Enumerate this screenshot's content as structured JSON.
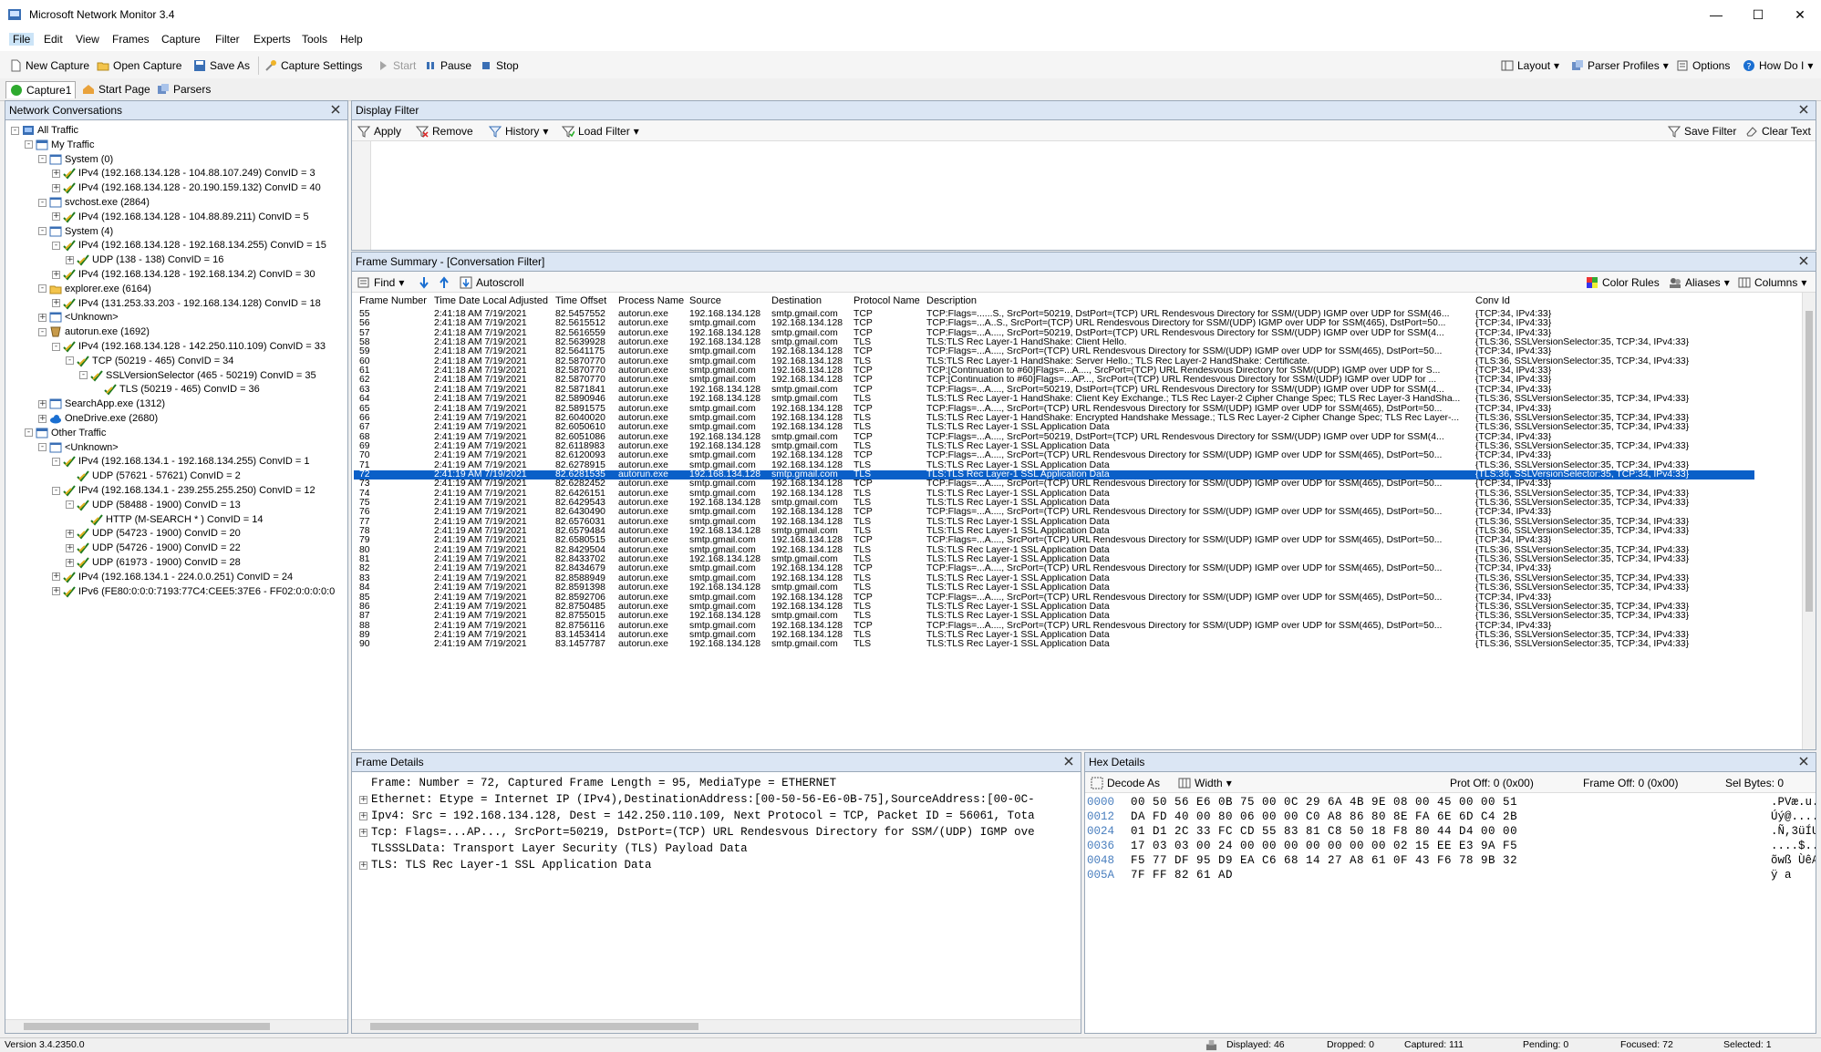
{
  "window": {
    "title": "Microsoft Network Monitor 3.4",
    "controls": {
      "minimize": "—",
      "maximize": "☐",
      "close": "✕"
    }
  },
  "menu": [
    "File",
    "Edit",
    "View",
    "Frames",
    "Capture",
    "Filter",
    "Experts",
    "Tools",
    "Help"
  ],
  "toolbar": {
    "new_capture": "New Capture",
    "open_capture": "Open Capture",
    "save_as": "Save As",
    "capture_settings": "Capture Settings",
    "start": "Start",
    "pause": "Pause",
    "stop": "Stop",
    "layout": "Layout",
    "parser_profiles": "Parser Profiles",
    "options": "Options",
    "how_do_i": "How Do I"
  },
  "doc_tabs": [
    "Capture1",
    "Start Page",
    "Parsers"
  ],
  "conversations": {
    "title": "Network Conversations",
    "tree": [
      {
        "level": 0,
        "exp": "-",
        "icon": "globe",
        "label": "All Traffic"
      },
      {
        "level": 1,
        "exp": "-",
        "icon": "folder",
        "label": "My Traffic"
      },
      {
        "level": 2,
        "exp": "-",
        "icon": "window",
        "label": "System (0)"
      },
      {
        "level": 3,
        "exp": "+",
        "icon": "check",
        "label": "IPv4 (192.168.134.128 - 104.88.107.249) ConvID = 3"
      },
      {
        "level": 3,
        "exp": "+",
        "icon": "check",
        "label": "IPv4 (192.168.134.128 - 20.190.159.132) ConvID = 40"
      },
      {
        "level": 2,
        "exp": "-",
        "icon": "window",
        "label": "svchost.exe (2864)"
      },
      {
        "level": 3,
        "exp": "+",
        "icon": "check",
        "label": "IPv4 (192.168.134.128 - 104.88.89.211) ConvID = 5"
      },
      {
        "level": 2,
        "exp": "-",
        "icon": "window",
        "label": "System (4)"
      },
      {
        "level": 3,
        "exp": "-",
        "icon": "check",
        "label": "IPv4 (192.168.134.128 - 192.168.134.255) ConvID = 15"
      },
      {
        "level": 4,
        "exp": "+",
        "icon": "check",
        "label": "UDP (138 - 138) ConvID = 16"
      },
      {
        "level": 3,
        "exp": "+",
        "icon": "check",
        "label": "IPv4 (192.168.134.128 - 192.168.134.2) ConvID = 30"
      },
      {
        "level": 2,
        "exp": "-",
        "icon": "explorer",
        "label": "explorer.exe (6164)"
      },
      {
        "level": 3,
        "exp": "+",
        "icon": "check",
        "label": "IPv4 (131.253.33.203 - 192.168.134.128) ConvID = 18"
      },
      {
        "level": 2,
        "exp": "+",
        "icon": "window",
        "label": "<Unknown>"
      },
      {
        "level": 2,
        "exp": "-",
        "icon": "autorun",
        "label": "autorun.exe (1692)"
      },
      {
        "level": 3,
        "exp": "-",
        "icon": "check",
        "label": "IPv4 (192.168.134.128 - 142.250.110.109) ConvID = 33"
      },
      {
        "level": 4,
        "exp": "-",
        "icon": "check",
        "label": "TCP (50219 - 465) ConvID = 34"
      },
      {
        "level": 5,
        "exp": "-",
        "icon": "check",
        "label": "SSLVersionSelector (465 - 50219) ConvID = 35"
      },
      {
        "level": 6,
        "exp": "",
        "icon": "check",
        "label": "TLS (50219 - 465) ConvID = 36"
      },
      {
        "level": 2,
        "exp": "+",
        "icon": "window",
        "label": "SearchApp.exe (1312)"
      },
      {
        "level": 2,
        "exp": "+",
        "icon": "cloud",
        "label": "OneDrive.exe (2680)"
      },
      {
        "level": 1,
        "exp": "-",
        "icon": "folder",
        "label": "Other Traffic"
      },
      {
        "level": 2,
        "exp": "-",
        "icon": "window",
        "label": "<Unknown>"
      },
      {
        "level": 3,
        "exp": "-",
        "icon": "check",
        "label": "IPv4 (192.168.134.1 - 192.168.134.255) ConvID = 1"
      },
      {
        "level": 4,
        "exp": "",
        "icon": "check",
        "label": "UDP (57621 - 57621) ConvID = 2"
      },
      {
        "level": 3,
        "exp": "-",
        "icon": "check",
        "label": "IPv4 (192.168.134.1 - 239.255.255.250) ConvID = 12"
      },
      {
        "level": 4,
        "exp": "-",
        "icon": "check",
        "label": "UDP (58488 - 1900) ConvID = 13"
      },
      {
        "level": 5,
        "exp": "",
        "icon": "check",
        "label": "HTTP (M-SEARCH * ) ConvID = 14"
      },
      {
        "level": 4,
        "exp": "+",
        "icon": "check",
        "label": "UDP (54723 - 1900) ConvID = 20"
      },
      {
        "level": 4,
        "exp": "+",
        "icon": "check",
        "label": "UDP (54726 - 1900) ConvID = 22"
      },
      {
        "level": 4,
        "exp": "+",
        "icon": "check",
        "label": "UDP (61973 - 1900) ConvID = 28"
      },
      {
        "level": 3,
        "exp": "+",
        "icon": "check",
        "label": "IPv4 (192.168.134.1 - 224.0.0.251) ConvID = 24"
      },
      {
        "level": 3,
        "exp": "+",
        "icon": "check",
        "label": "IPv6 (FE80:0:0:0:7193:77C4:CEE5:37E6 - FF02:0:0:0:0:0"
      }
    ]
  },
  "display_filter": {
    "title": "Display Filter",
    "apply": "Apply",
    "remove": "Remove",
    "history": "History",
    "load_filter": "Load Filter",
    "save_filter": "Save Filter",
    "clear_text": "Clear Text"
  },
  "frame_summary": {
    "title": "Frame Summary - [Conversation Filter]",
    "find": "Find",
    "autoscroll": "Autoscroll",
    "color_rules": "Color Rules",
    "aliases": "Aliases",
    "columns": "Columns",
    "headers": [
      "Frame Number",
      "Time Date Local Adjusted",
      "Time Offset",
      "Process Name",
      "Source",
      "Destination",
      "Protocol Name",
      "Description",
      "Conv Id"
    ],
    "selected_frame": "72",
    "rows": [
      [
        "55",
        "2:41:18 AM 7/19/2021",
        "82.5457552",
        "autorun.exe",
        "192.168.134.128",
        "smtp.gmail.com",
        "TCP",
        "TCP:Flags=......S., SrcPort=50219, DstPort=(TCP) URL Rendesvous Directory for SSM/(UDP) IGMP over UDP for SSM(46...",
        "{TCP:34, IPv4:33}"
      ],
      [
        "56",
        "2:41:18 AM 7/19/2021",
        "82.5615512",
        "autorun.exe",
        "smtp.gmail.com",
        "192.168.134.128",
        "TCP",
        "TCP:Flags=...A..S., SrcPort=(TCP) URL Rendesvous Directory for SSM/(UDP) IGMP over UDP for SSM(465), DstPort=50...",
        "{TCP:34, IPv4:33}"
      ],
      [
        "57",
        "2:41:18 AM 7/19/2021",
        "82.5616559",
        "autorun.exe",
        "192.168.134.128",
        "smtp.gmail.com",
        "TCP",
        "TCP:Flags=...A...., SrcPort=50219, DstPort=(TCP) URL Rendesvous Directory for SSM/(UDP) IGMP over UDP for SSM(4...",
        "{TCP:34, IPv4:33}"
      ],
      [
        "58",
        "2:41:18 AM 7/19/2021",
        "82.5639928",
        "autorun.exe",
        "192.168.134.128",
        "smtp.gmail.com",
        "TLS",
        "TLS:TLS Rec Layer-1 HandShake: Client Hello.",
        "{TLS:36, SSLVersionSelector:35, TCP:34, IPv4:33}"
      ],
      [
        "59",
        "2:41:18 AM 7/19/2021",
        "82.5641175",
        "autorun.exe",
        "smtp.gmail.com",
        "192.168.134.128",
        "TCP",
        "TCP:Flags=...A...., SrcPort=(TCP) URL Rendesvous Directory for SSM/(UDP) IGMP over UDP for SSM(465), DstPort=50...",
        "{TCP:34, IPv4:33}"
      ],
      [
        "60",
        "2:41:18 AM 7/19/2021",
        "82.5870770",
        "autorun.exe",
        "smtp.gmail.com",
        "192.168.134.128",
        "TLS",
        "TLS:TLS Rec Layer-1 HandShake: Server Hello.; TLS Rec Layer-2 HandShake: Certificate.",
        "{TLS:36, SSLVersionSelector:35, TCP:34, IPv4:33}"
      ],
      [
        "61",
        "2:41:18 AM 7/19/2021",
        "82.5870770",
        "autorun.exe",
        "smtp.gmail.com",
        "192.168.134.128",
        "TCP",
        "TCP:[Continuation to #60]Flags=...A...., SrcPort=(TCP) URL Rendesvous Directory for SSM/(UDP) IGMP over UDP for S...",
        "{TCP:34, IPv4:33}"
      ],
      [
        "62",
        "2:41:18 AM 7/19/2021",
        "82.5870770",
        "autorun.exe",
        "smtp.gmail.com",
        "192.168.134.128",
        "TCP",
        "TCP:[Continuation to #60]Flags=...AP..., SrcPort=(TCP) URL Rendesvous Directory for SSM/(UDP) IGMP over UDP for ...",
        "{TCP:34, IPv4:33}"
      ],
      [
        "63",
        "2:41:18 AM 7/19/2021",
        "82.5871841",
        "autorun.exe",
        "192.168.134.128",
        "smtp.gmail.com",
        "TCP",
        "TCP:Flags=...A...., SrcPort=50219, DstPort=(TCP) URL Rendesvous Directory for SSM/(UDP) IGMP over UDP for SSM(4...",
        "{TCP:34, IPv4:33}"
      ],
      [
        "64",
        "2:41:18 AM 7/19/2021",
        "82.5890946",
        "autorun.exe",
        "192.168.134.128",
        "smtp.gmail.com",
        "TLS",
        "TLS:TLS Rec Layer-1 HandShake: Client Key Exchange.; TLS Rec Layer-2 Cipher Change Spec; TLS Rec Layer-3 HandSha...",
        "{TLS:36, SSLVersionSelector:35, TCP:34, IPv4:33}"
      ],
      [
        "65",
        "2:41:18 AM 7/19/2021",
        "82.5891575",
        "autorun.exe",
        "smtp.gmail.com",
        "192.168.134.128",
        "TCP",
        "TCP:Flags=...A...., SrcPort=(TCP) URL Rendesvous Directory for SSM/(UDP) IGMP over UDP for SSM(465), DstPort=50...",
        "{TCP:34, IPv4:33}"
      ],
      [
        "66",
        "2:41:19 AM 7/19/2021",
        "82.6040020",
        "autorun.exe",
        "smtp.gmail.com",
        "192.168.134.128",
        "TLS",
        "TLS:TLS Rec Layer-1 HandShake: Encrypted Handshake Message.; TLS Rec Layer-2 Cipher Change Spec; TLS Rec Layer-...",
        "{TLS:36, SSLVersionSelector:35, TCP:34, IPv4:33}"
      ],
      [
        "67",
        "2:41:19 AM 7/19/2021",
        "82.6050610",
        "autorun.exe",
        "smtp.gmail.com",
        "192.168.134.128",
        "TLS",
        "TLS:TLS Rec Layer-1 SSL Application Data",
        "{TLS:36, SSLVersionSelector:35, TCP:34, IPv4:33}"
      ],
      [
        "68",
        "2:41:19 AM 7/19/2021",
        "82.6051086",
        "autorun.exe",
        "192.168.134.128",
        "smtp.gmail.com",
        "TCP",
        "TCP:Flags=...A...., SrcPort=50219, DstPort=(TCP) URL Rendesvous Directory for SSM/(UDP) IGMP over UDP for SSM(4...",
        "{TCP:34, IPv4:33}"
      ],
      [
        "69",
        "2:41:19 AM 7/19/2021",
        "82.6118983",
        "autorun.exe",
        "192.168.134.128",
        "smtp.gmail.com",
        "TLS",
        "TLS:TLS Rec Layer-1 SSL Application Data",
        "{TLS:36, SSLVersionSelector:35, TCP:34, IPv4:33}"
      ],
      [
        "70",
        "2:41:19 AM 7/19/2021",
        "82.6120093",
        "autorun.exe",
        "smtp.gmail.com",
        "192.168.134.128",
        "TCP",
        "TCP:Flags=...A...., SrcPort=(TCP) URL Rendesvous Directory for SSM/(UDP) IGMP over UDP for SSM(465), DstPort=50...",
        "{TCP:34, IPv4:33}"
      ],
      [
        "71",
        "2:41:19 AM 7/19/2021",
        "82.6278915",
        "autorun.exe",
        "smtp.gmail.com",
        "192.168.134.128",
        "TLS",
        "TLS:TLS Rec Layer-1 SSL Application Data",
        "{TLS:36, SSLVersionSelector:35, TCP:34, IPv4:33}"
      ],
      [
        "72",
        "2:41:19 AM 7/19/2021",
        "82.6281535",
        "autorun.exe",
        "192.168.134.128",
        "smtp.gmail.com",
        "TLS",
        "TLS:TLS Rec Layer-1 SSL Application Data",
        "{TLS:36, SSLVersionSelector:35, TCP:34, IPv4:33}"
      ],
      [
        "73",
        "2:41:19 AM 7/19/2021",
        "82.6282452",
        "autorun.exe",
        "smtp.gmail.com",
        "192.168.134.128",
        "TCP",
        "TCP:Flags=...A...., SrcPort=(TCP) URL Rendesvous Directory for SSM/(UDP) IGMP over UDP for SSM(465), DstPort=50...",
        "{TCP:34, IPv4:33}"
      ],
      [
        "74",
        "2:41:19 AM 7/19/2021",
        "82.6426151",
        "autorun.exe",
        "smtp.gmail.com",
        "192.168.134.128",
        "TLS",
        "TLS:TLS Rec Layer-1 SSL Application Data",
        "{TLS:36, SSLVersionSelector:35, TCP:34, IPv4:33}"
      ],
      [
        "75",
        "2:41:19 AM 7/19/2021",
        "82.6429543",
        "autorun.exe",
        "192.168.134.128",
        "smtp.gmail.com",
        "TLS",
        "TLS:TLS Rec Layer-1 SSL Application Data",
        "{TLS:36, SSLVersionSelector:35, TCP:34, IPv4:33}"
      ],
      [
        "76",
        "2:41:19 AM 7/19/2021",
        "82.6430490",
        "autorun.exe",
        "smtp.gmail.com",
        "192.168.134.128",
        "TCP",
        "TCP:Flags=...A...., SrcPort=(TCP) URL Rendesvous Directory for SSM/(UDP) IGMP over UDP for SSM(465), DstPort=50...",
        "{TCP:34, IPv4:33}"
      ],
      [
        "77",
        "2:41:19 AM 7/19/2021",
        "82.6576031",
        "autorun.exe",
        "smtp.gmail.com",
        "192.168.134.128",
        "TLS",
        "TLS:TLS Rec Layer-1 SSL Application Data",
        "{TLS:36, SSLVersionSelector:35, TCP:34, IPv4:33}"
      ],
      [
        "78",
        "2:41:19 AM 7/19/2021",
        "82.6579484",
        "autorun.exe",
        "192.168.134.128",
        "smtp.gmail.com",
        "TLS",
        "TLS:TLS Rec Layer-1 SSL Application Data",
        "{TLS:36, SSLVersionSelector:35, TCP:34, IPv4:33}"
      ],
      [
        "79",
        "2:41:19 AM 7/19/2021",
        "82.6580515",
        "autorun.exe",
        "smtp.gmail.com",
        "192.168.134.128",
        "TCP",
        "TCP:Flags=...A...., SrcPort=(TCP) URL Rendesvous Directory for SSM/(UDP) IGMP over UDP for SSM(465), DstPort=50...",
        "{TCP:34, IPv4:33}"
      ],
      [
        "80",
        "2:41:19 AM 7/19/2021",
        "82.8429504",
        "autorun.exe",
        "smtp.gmail.com",
        "192.168.134.128",
        "TLS",
        "TLS:TLS Rec Layer-1 SSL Application Data",
        "{TLS:36, SSLVersionSelector:35, TCP:34, IPv4:33}"
      ],
      [
        "81",
        "2:41:19 AM 7/19/2021",
        "82.8433702",
        "autorun.exe",
        "192.168.134.128",
        "smtp.gmail.com",
        "TLS",
        "TLS:TLS Rec Layer-1 SSL Application Data",
        "{TLS:36, SSLVersionSelector:35, TCP:34, IPv4:33}"
      ],
      [
        "82",
        "2:41:19 AM 7/19/2021",
        "82.8434679",
        "autorun.exe",
        "smtp.gmail.com",
        "192.168.134.128",
        "TCP",
        "TCP:Flags=...A...., SrcPort=(TCP) URL Rendesvous Directory for SSM/(UDP) IGMP over UDP for SSM(465), DstPort=50...",
        "{TCP:34, IPv4:33}"
      ],
      [
        "83",
        "2:41:19 AM 7/19/2021",
        "82.8588949",
        "autorun.exe",
        "smtp.gmail.com",
        "192.168.134.128",
        "TLS",
        "TLS:TLS Rec Layer-1 SSL Application Data",
        "{TLS:36, SSLVersionSelector:35, TCP:34, IPv4:33}"
      ],
      [
        "84",
        "2:41:19 AM 7/19/2021",
        "82.8591398",
        "autorun.exe",
        "192.168.134.128",
        "smtp.gmail.com",
        "TLS",
        "TLS:TLS Rec Layer-1 SSL Application Data",
        "{TLS:36, SSLVersionSelector:35, TCP:34, IPv4:33}"
      ],
      [
        "85",
        "2:41:19 AM 7/19/2021",
        "82.8592706",
        "autorun.exe",
        "smtp.gmail.com",
        "192.168.134.128",
        "TCP",
        "TCP:Flags=...A...., SrcPort=(TCP) URL Rendesvous Directory for SSM/(UDP) IGMP over UDP for SSM(465), DstPort=50...",
        "{TCP:34, IPv4:33}"
      ],
      [
        "86",
        "2:41:19 AM 7/19/2021",
        "82.8750485",
        "autorun.exe",
        "smtp.gmail.com",
        "192.168.134.128",
        "TLS",
        "TLS:TLS Rec Layer-1 SSL Application Data",
        "{TLS:36, SSLVersionSelector:35, TCP:34, IPv4:33}"
      ],
      [
        "87",
        "2:41:19 AM 7/19/2021",
        "82.8755015",
        "autorun.exe",
        "192.168.134.128",
        "smtp.gmail.com",
        "TLS",
        "TLS:TLS Rec Layer-1 SSL Application Data",
        "{TLS:36, SSLVersionSelector:35, TCP:34, IPv4:33}"
      ],
      [
        "88",
        "2:41:19 AM 7/19/2021",
        "82.8756116",
        "autorun.exe",
        "smtp.gmail.com",
        "192.168.134.128",
        "TCP",
        "TCP:Flags=...A...., SrcPort=(TCP) URL Rendesvous Directory for SSM/(UDP) IGMP over UDP for SSM(465), DstPort=50...",
        "{TCP:34, IPv4:33}"
      ],
      [
        "89",
        "2:41:19 AM 7/19/2021",
        "83.1453414",
        "autorun.exe",
        "smtp.gmail.com",
        "192.168.134.128",
        "TLS",
        "TLS:TLS Rec Layer-1 SSL Application Data",
        "{TLS:36, SSLVersionSelector:35, TCP:34, IPv4:33}"
      ],
      [
        "90",
        "2:41:19 AM 7/19/2021",
        "83.1457787",
        "autorun.exe",
        "192.168.134.128",
        "smtp.gmail.com",
        "TLS",
        "TLS:TLS Rec Layer-1 SSL Application Data",
        "{TLS:36, SSLVersionSelector:35, TCP:34, IPv4:33}"
      ]
    ]
  },
  "frame_details": {
    "title": "Frame Details",
    "lines": [
      {
        "exp": "",
        "text": "Frame: Number = 72, Captured Frame Length = 95, MediaType = ETHERNET"
      },
      {
        "exp": "+",
        "text": "Ethernet: Etype = Internet IP (IPv4),DestinationAddress:[00-50-56-E6-0B-75],SourceAddress:[00-0C-"
      },
      {
        "exp": "+",
        "text": "Ipv4: Src = 192.168.134.128, Dest = 142.250.110.109, Next Protocol = TCP, Packet ID = 56061, Tota"
      },
      {
        "exp": "+",
        "text": "Tcp: Flags=...AP..., SrcPort=50219, DstPort=(TCP) URL Rendesvous Directory for SSM/(UDP) IGMP ove"
      },
      {
        "exp": "",
        "text": "TLSSSLData: Transport Layer Security (TLS) Payload Data"
      },
      {
        "exp": "+",
        "text": "TLS: TLS Rec Layer-1 SSL Application Data"
      }
    ]
  },
  "hex_details": {
    "title": "Hex Details",
    "decode_as": "Decode As",
    "width": "Width",
    "prot_off": "Prot Off: 0 (0x00)",
    "frame_off": "Frame Off: 0 (0x00)",
    "sel_bytes": "Sel Bytes: 0",
    "rows": [
      {
        "off": "0000",
        "bytes": "00 50 56 E6 0B 75 00 0C 29 6A 4B 9E 08 00 45 00 00 51",
        "ascii": ".PVæ.u..)jK ..E.Q"
      },
      {
        "off": "0012",
        "bytes": "DA FD 40 00 80 06 00 00 C0 A8 86 80 8E FA 6E 6D C4 2B",
        "ascii": "Úý@.....À¨  úmnÄ+"
      },
      {
        "off": "0024",
        "bytes": "01 D1 2C 33 FC CD 55 83 81 C8 50 18 F8 80 44 D4 00 00",
        "ascii": ".Ñ,3üÍU  ÈP.ø DÔ.."
      },
      {
        "off": "0036",
        "bytes": "17 03 03 00 24 00 00 00 00 00 00 00 02 15 EE E3 9A F5",
        "ascii": "....$.......îã õ"
      },
      {
        "off": "0048",
        "bytes": "F5 77 DF 95 D9 EA C6 68 14 27 A8 61 0F 43 F6 78 9B 32",
        "ascii": "õwß ÙêÆh.'¨a.Cöx 2"
      },
      {
        "off": "005A",
        "bytes": "7F FF 82 61 AD",
        "ascii": " ÿ a­"
      }
    ]
  },
  "status": {
    "version": "Version 3.4.2350.0",
    "displayed": "Displayed: 46",
    "dropped": "Dropped: 0",
    "captured": "Captured: 111",
    "pending": "Pending: 0",
    "focused": "Focused: 72",
    "selected": "Selected: 1"
  },
  "colors": {
    "selection": "#0a5fc8",
    "panel_header": "#dbe6f4",
    "accent": "#1b6fd1"
  }
}
